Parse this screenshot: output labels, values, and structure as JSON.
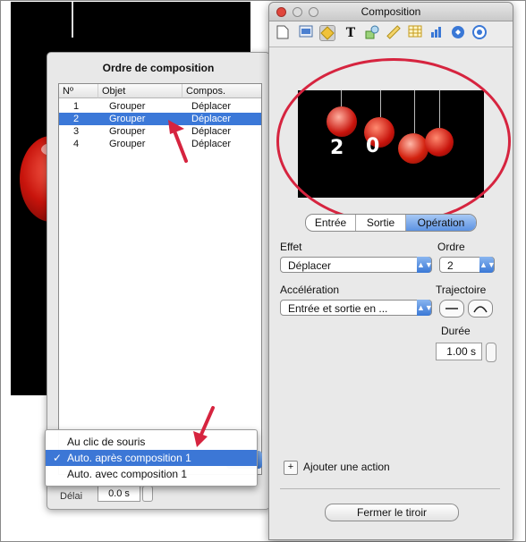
{
  "order_panel": {
    "title": "Ordre de composition",
    "columns": [
      "Nº",
      "Objet",
      "Compos."
    ],
    "rows": [
      {
        "num": "1",
        "object": "Grouper",
        "compos": "Déplacer",
        "selected": false
      },
      {
        "num": "2",
        "object": "Grouper",
        "compos": "Déplacer",
        "selected": true
      },
      {
        "num": "3",
        "object": "Grouper",
        "compos": "Déplacer",
        "selected": false
      },
      {
        "num": "4",
        "object": "Grouper",
        "compos": "Déplacer",
        "selected": false
      }
    ],
    "delay_label": "Délai",
    "delay_value": "0.0 s"
  },
  "start_menu": {
    "items": [
      {
        "label": "Au clic de souris",
        "checked": false
      },
      {
        "label": "Auto. après composition 1",
        "checked": true
      },
      {
        "label": "Auto. avec composition 1",
        "checked": false
      }
    ],
    "check_glyph": "✓"
  },
  "inspector": {
    "title": "Composition",
    "toolbar_icons": [
      "document-icon",
      "layout-icon",
      "build-icon",
      "text-icon",
      "shapes-icon",
      "metrics-icon",
      "table-icon",
      "chart-icon",
      "hyperlink-icon",
      "quicktime-icon"
    ],
    "preview_digits": [
      "2",
      "0"
    ],
    "tabs": [
      {
        "label": "Entrée",
        "active": false
      },
      {
        "label": "Sortie",
        "active": false
      },
      {
        "label": "Opération",
        "active": true
      }
    ],
    "effect_label": "Effet",
    "effect_value": "Déplacer",
    "order_label": "Ordre",
    "order_value": "2",
    "accel_label": "Accélération",
    "accel_value": "Entrée et sortie en ...",
    "trajectory_label": "Trajectoire",
    "duration_label": "Durée",
    "duration_value": "1.00 s",
    "add_action_label": "Ajouter une action",
    "add_glyph": "+",
    "close_drawer_label": "Fermer le tiroir"
  },
  "colors": {
    "selection": "#3b78d8",
    "annotation": "#d6243f",
    "slide_background": "#000000"
  }
}
